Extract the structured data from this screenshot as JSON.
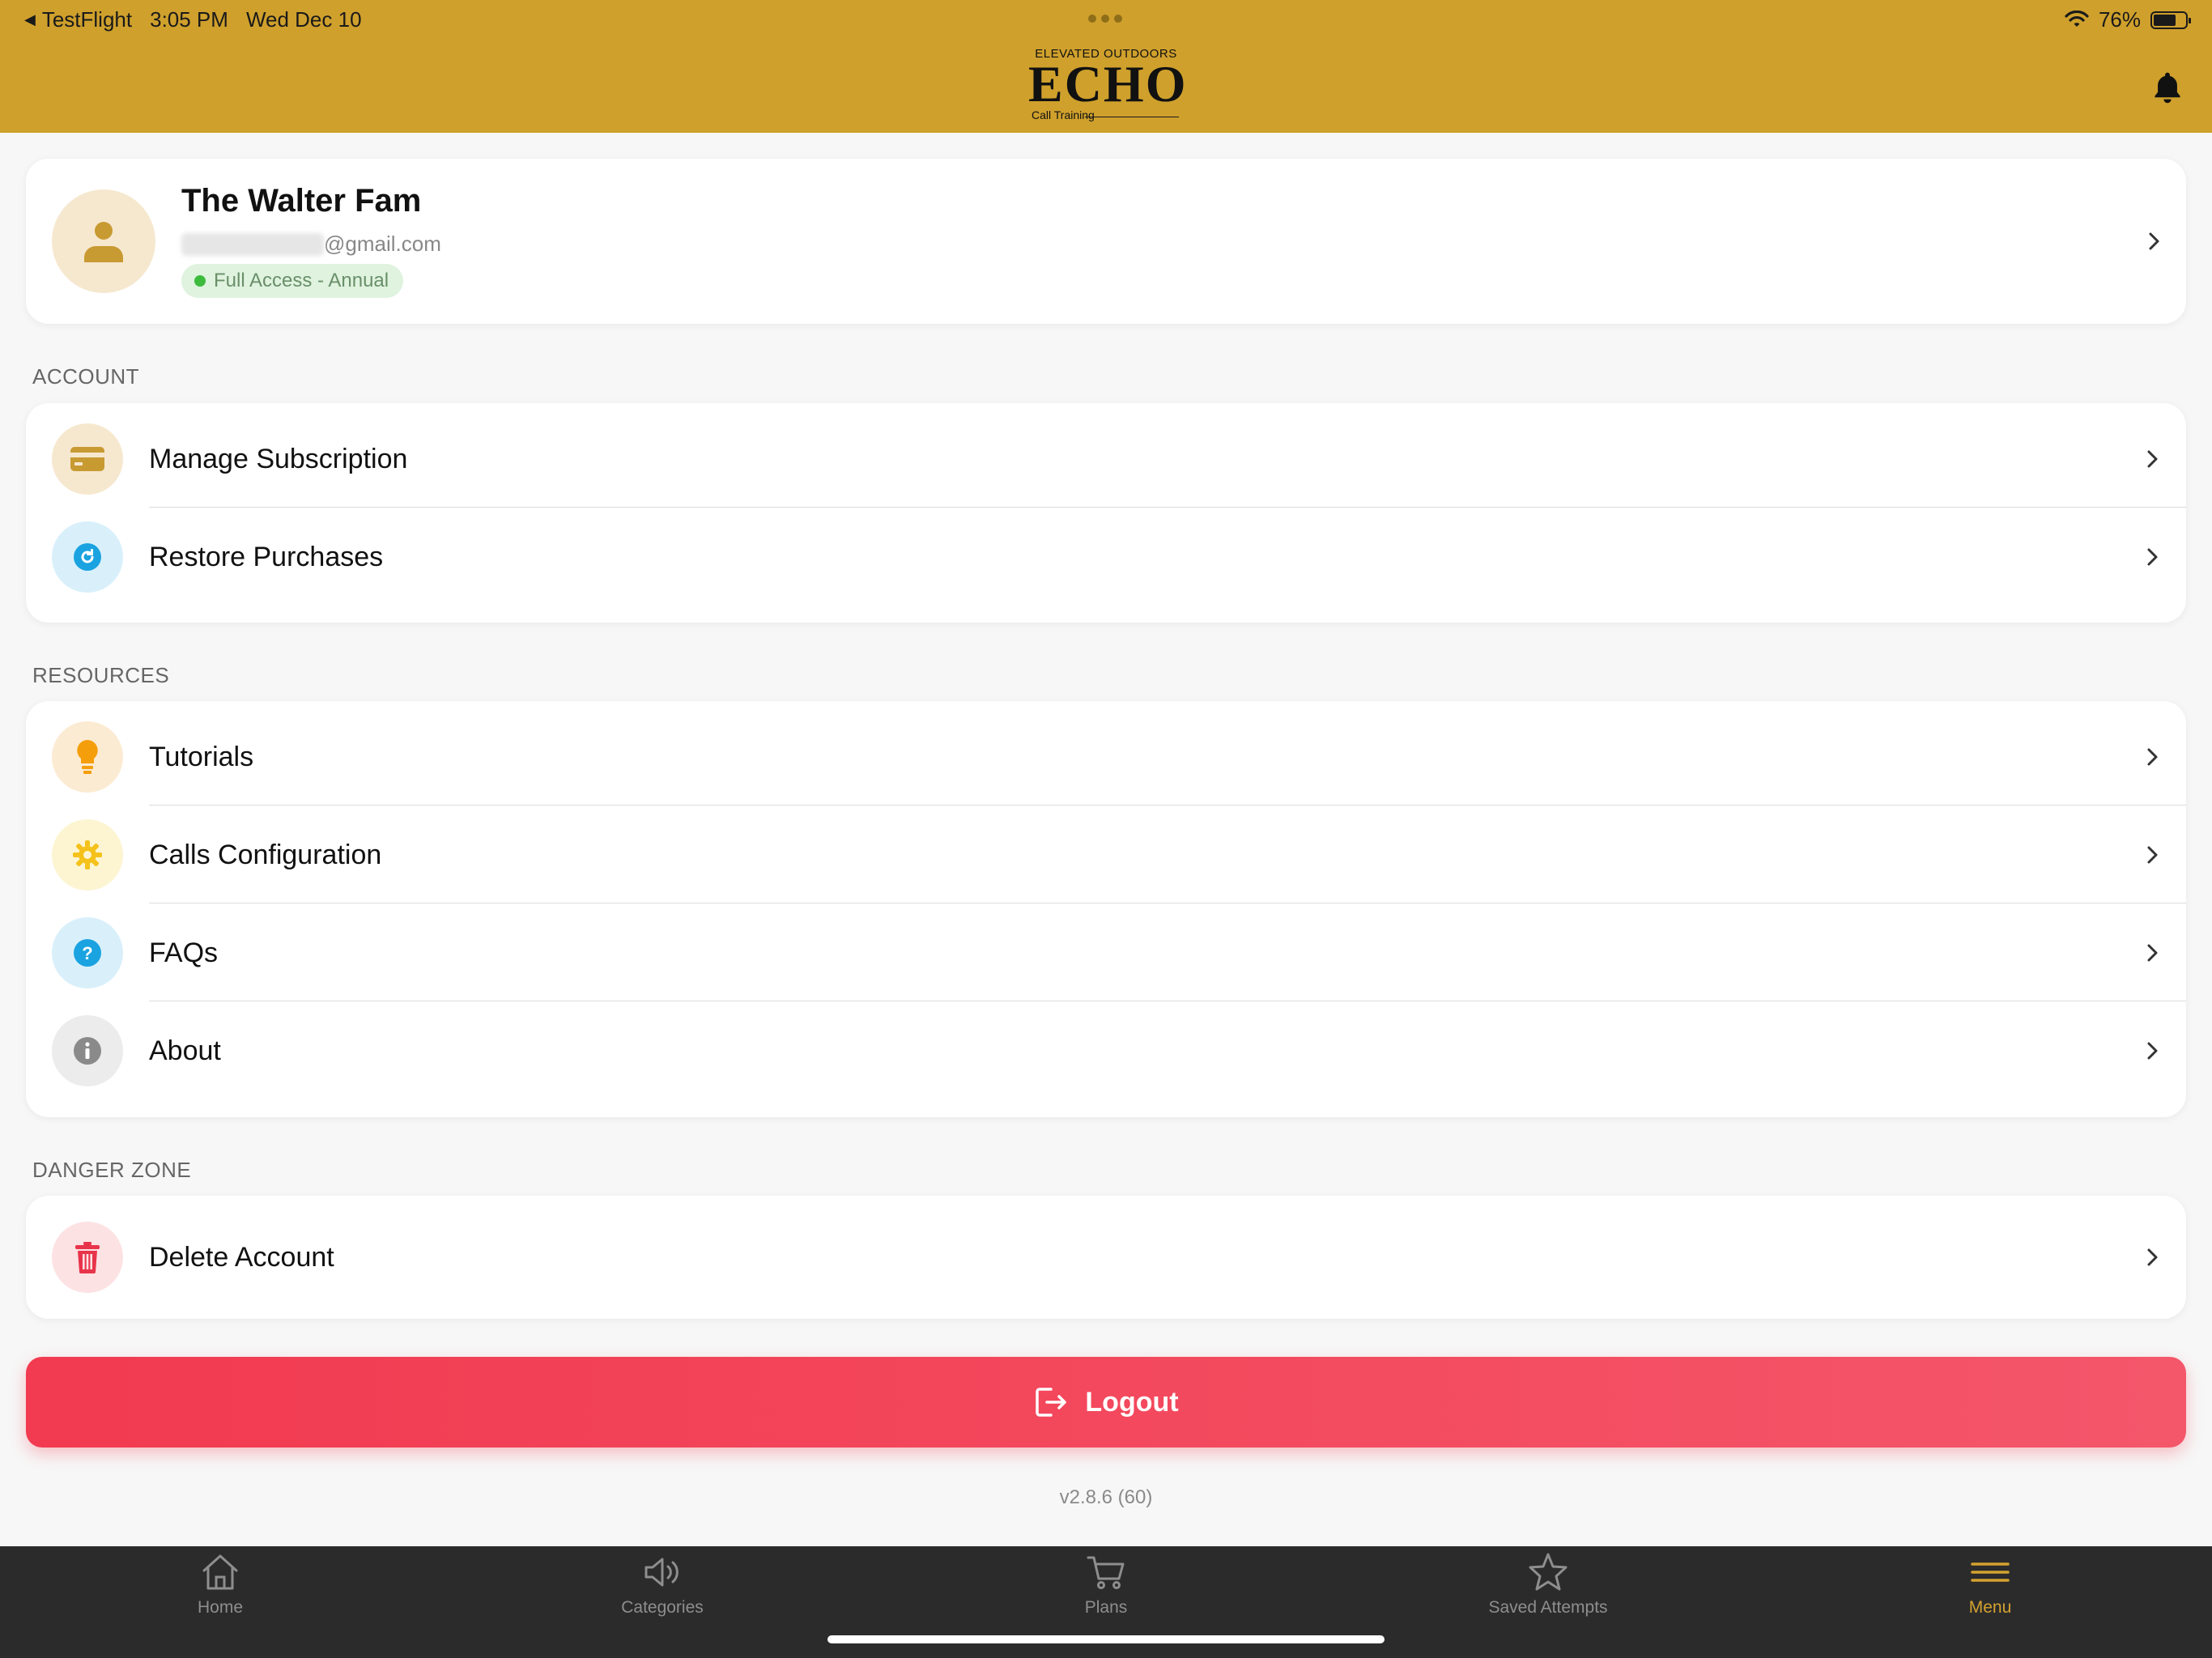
{
  "status_bar": {
    "back_app": "TestFlight",
    "time": "3:05 PM",
    "date": "Wed Dec 10",
    "battery": "76%"
  },
  "header": {
    "logo_top": "ELEVATED OUTDOORS",
    "logo_main": "ECHO",
    "logo_bottom": "Call Training"
  },
  "profile": {
    "name": "The Walter Fam",
    "email_suffix": "@gmail.com",
    "plan_badge": "Full Access - Annual"
  },
  "sections": {
    "account": {
      "title": "ACCOUNT",
      "items": [
        {
          "label": "Manage Subscription",
          "icon": "credit-card-icon"
        },
        {
          "label": "Restore Purchases",
          "icon": "refresh-icon"
        }
      ]
    },
    "resources": {
      "title": "RESOURCES",
      "items": [
        {
          "label": "Tutorials",
          "icon": "lightbulb-icon"
        },
        {
          "label": "Calls Configuration",
          "icon": "gear-icon"
        },
        {
          "label": "FAQs",
          "icon": "question-icon"
        },
        {
          "label": "About",
          "icon": "info-icon"
        }
      ]
    },
    "danger": {
      "title": "DANGER ZONE",
      "items": [
        {
          "label": "Delete Account",
          "icon": "trash-icon"
        }
      ]
    }
  },
  "logout_label": "Logout",
  "version": "v2.8.6 (60)",
  "tabs": [
    {
      "label": "Home",
      "icon": "home-icon"
    },
    {
      "label": "Categories",
      "icon": "speaker-icon"
    },
    {
      "label": "Plans",
      "icon": "cart-icon"
    },
    {
      "label": "Saved Attempts",
      "icon": "star-icon"
    },
    {
      "label": "Menu",
      "icon": "menu-icon",
      "active": true
    }
  ],
  "colors": {
    "header": "#cfa02c",
    "accent": "#d4a22e",
    "danger": "#f23a50",
    "tabbar": "#2b2b2b"
  }
}
